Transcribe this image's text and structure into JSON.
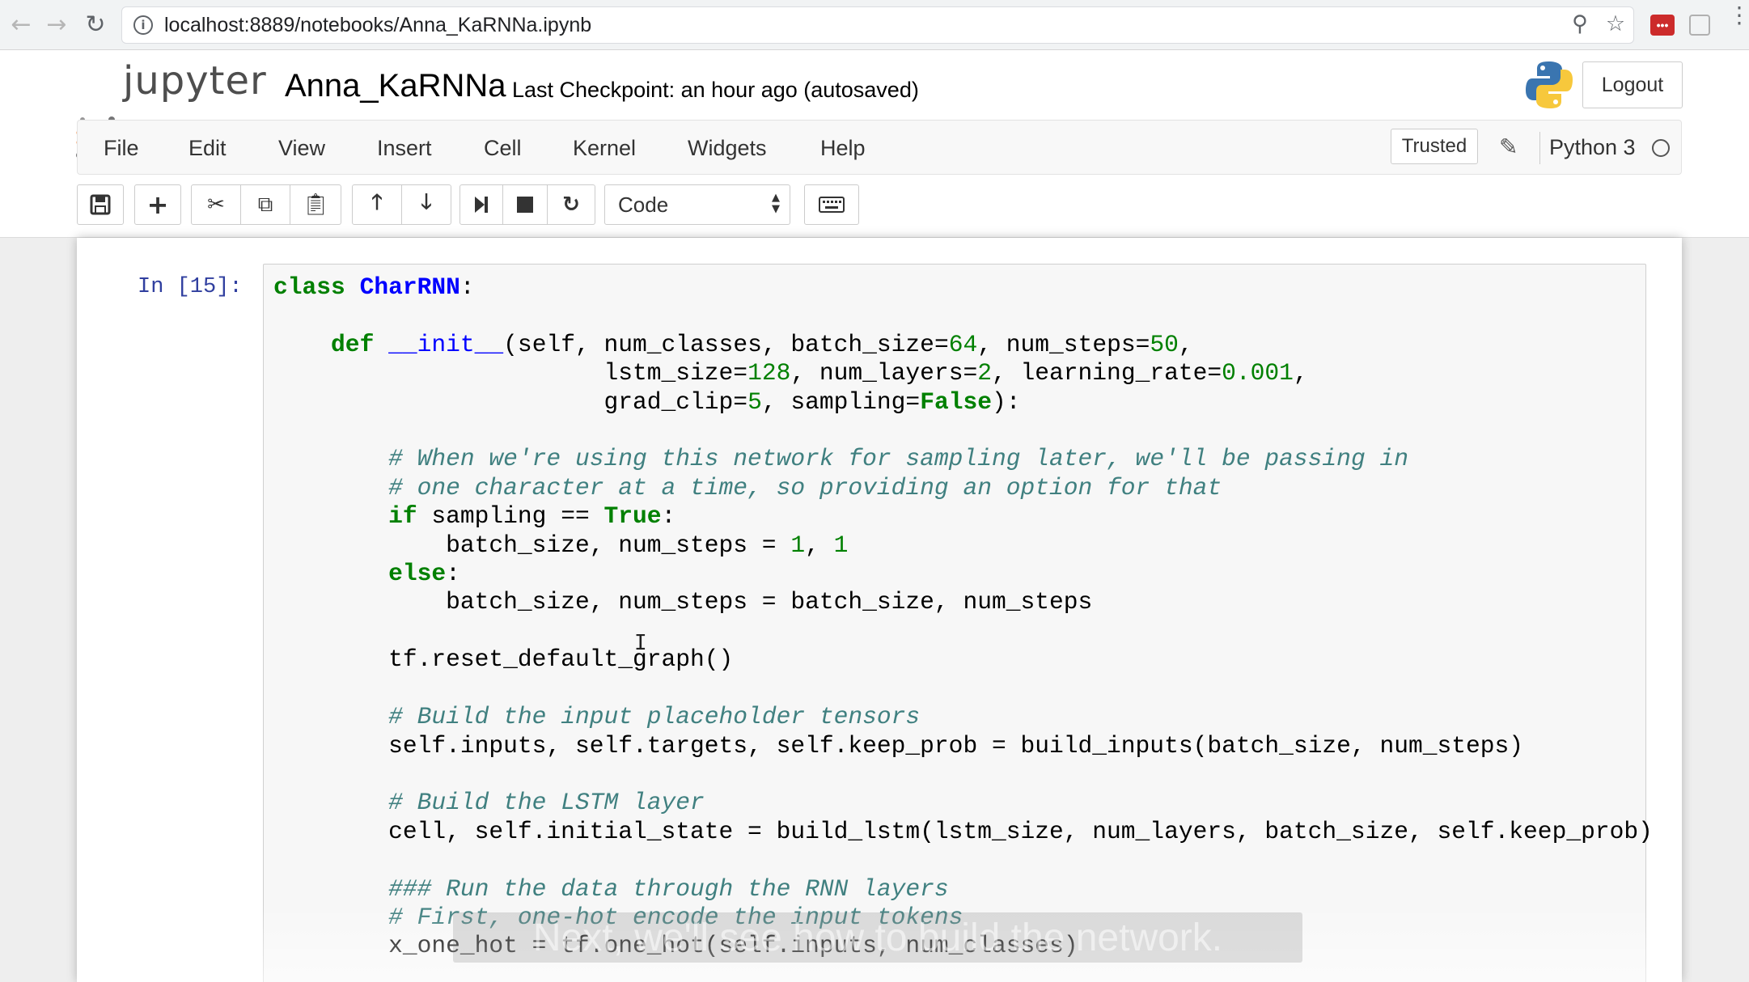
{
  "browser": {
    "url": "localhost:8889/notebooks/Anna_KaRNNa.ipynb",
    "back_icon": "arrow-left-icon",
    "forward_icon": "arrow-right-icon",
    "reload_icon": "reload-icon",
    "extension_label": "•••"
  },
  "header": {
    "logo_text": "jupyter",
    "notebook_name": "Anna_KaRNNa",
    "checkpoint": "Last Checkpoint: an hour ago (autosaved)",
    "logout_label": "Logout"
  },
  "menubar": {
    "items": [
      "File",
      "Edit",
      "View",
      "Insert",
      "Cell",
      "Kernel",
      "Widgets",
      "Help"
    ],
    "trusted_label": "Trusted",
    "kernel_name": "Python 3"
  },
  "toolbar": {
    "cell_type": "Code",
    "buttons": [
      "save-icon",
      "plus-icon",
      "cut-icon",
      "copy-icon",
      "paste-icon",
      "move-up-icon",
      "move-down-icon",
      "run-icon",
      "stop-icon",
      "restart-icon",
      "keyboard-icon"
    ]
  },
  "cell": {
    "prompt": "In [15]:"
  },
  "overlay": {
    "subtitle": "Next, we'll see how to build the network."
  },
  "colors": {
    "keyword": "#008000",
    "class_name": "#0000ff",
    "comment": "#408080",
    "prompt": "#303f9f"
  }
}
